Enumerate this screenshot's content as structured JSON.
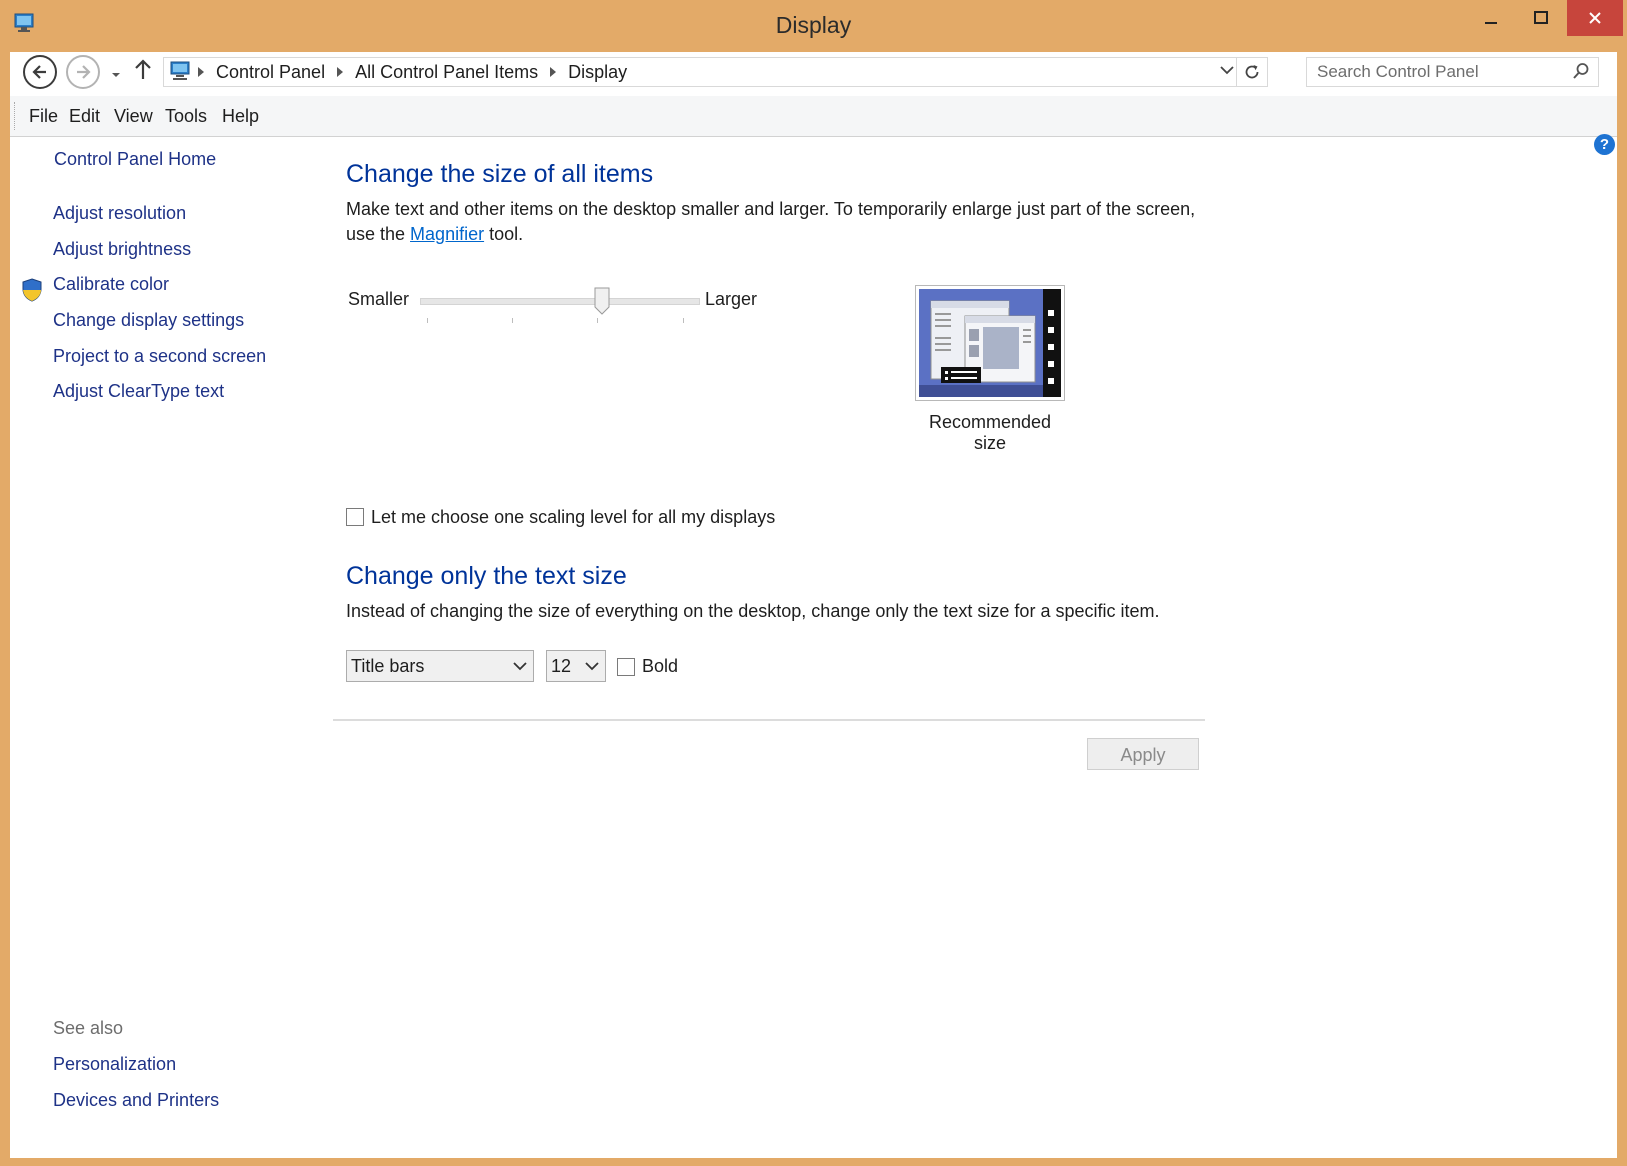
{
  "window": {
    "title": "Display",
    "app_icon": "control-panel-icon",
    "controls": {
      "minimize": "minimize-icon",
      "maximize": "maximize-icon",
      "close": "close-icon"
    },
    "frame_color": "#e3aa68",
    "close_color": "#c7453c"
  },
  "address_bar": {
    "breadcrumbs": [
      "Control Panel",
      "All Control Panel Items",
      "Display"
    ],
    "search_placeholder": "Search Control Panel"
  },
  "menu": [
    "File",
    "Edit",
    "View",
    "Tools",
    "Help"
  ],
  "sidebar": {
    "home": "Control Panel Home",
    "links": [
      "Adjust resolution",
      "Adjust brightness",
      "Calibrate color",
      "Change display settings",
      "Project to a second screen",
      "Adjust ClearType text"
    ],
    "see_also_label": "See also",
    "see_also": [
      "Personalization",
      "Devices and Printers"
    ]
  },
  "main": {
    "size_section": {
      "heading": "Change the size of all items",
      "desc_line1": "Make text and other items on the desktop smaller and larger. To temporarily enlarge just part of the screen,",
      "desc_line2_prefix": "use the ",
      "magnifier_link": "Magnifier",
      "desc_line2_suffix": " tool.",
      "slider_min_label": "Smaller",
      "slider_max_label": "Larger",
      "slider_level": 0.66,
      "preview_caption": "Recommended size"
    },
    "scaling_checkbox": {
      "label": "Let me choose one scaling level for all my displays",
      "checked": false
    },
    "text_section": {
      "heading": "Change only the text size",
      "desc": "Instead of changing the size of everything on the desktop, change only the text size for a specific item.",
      "item_select": "Title bars",
      "size_select": "12",
      "bold_label": "Bold",
      "bold_checked": false
    },
    "apply_label": "Apply"
  },
  "colors": {
    "heading": "#003399",
    "link": "#1e3287",
    "help": "#1e73d2"
  }
}
